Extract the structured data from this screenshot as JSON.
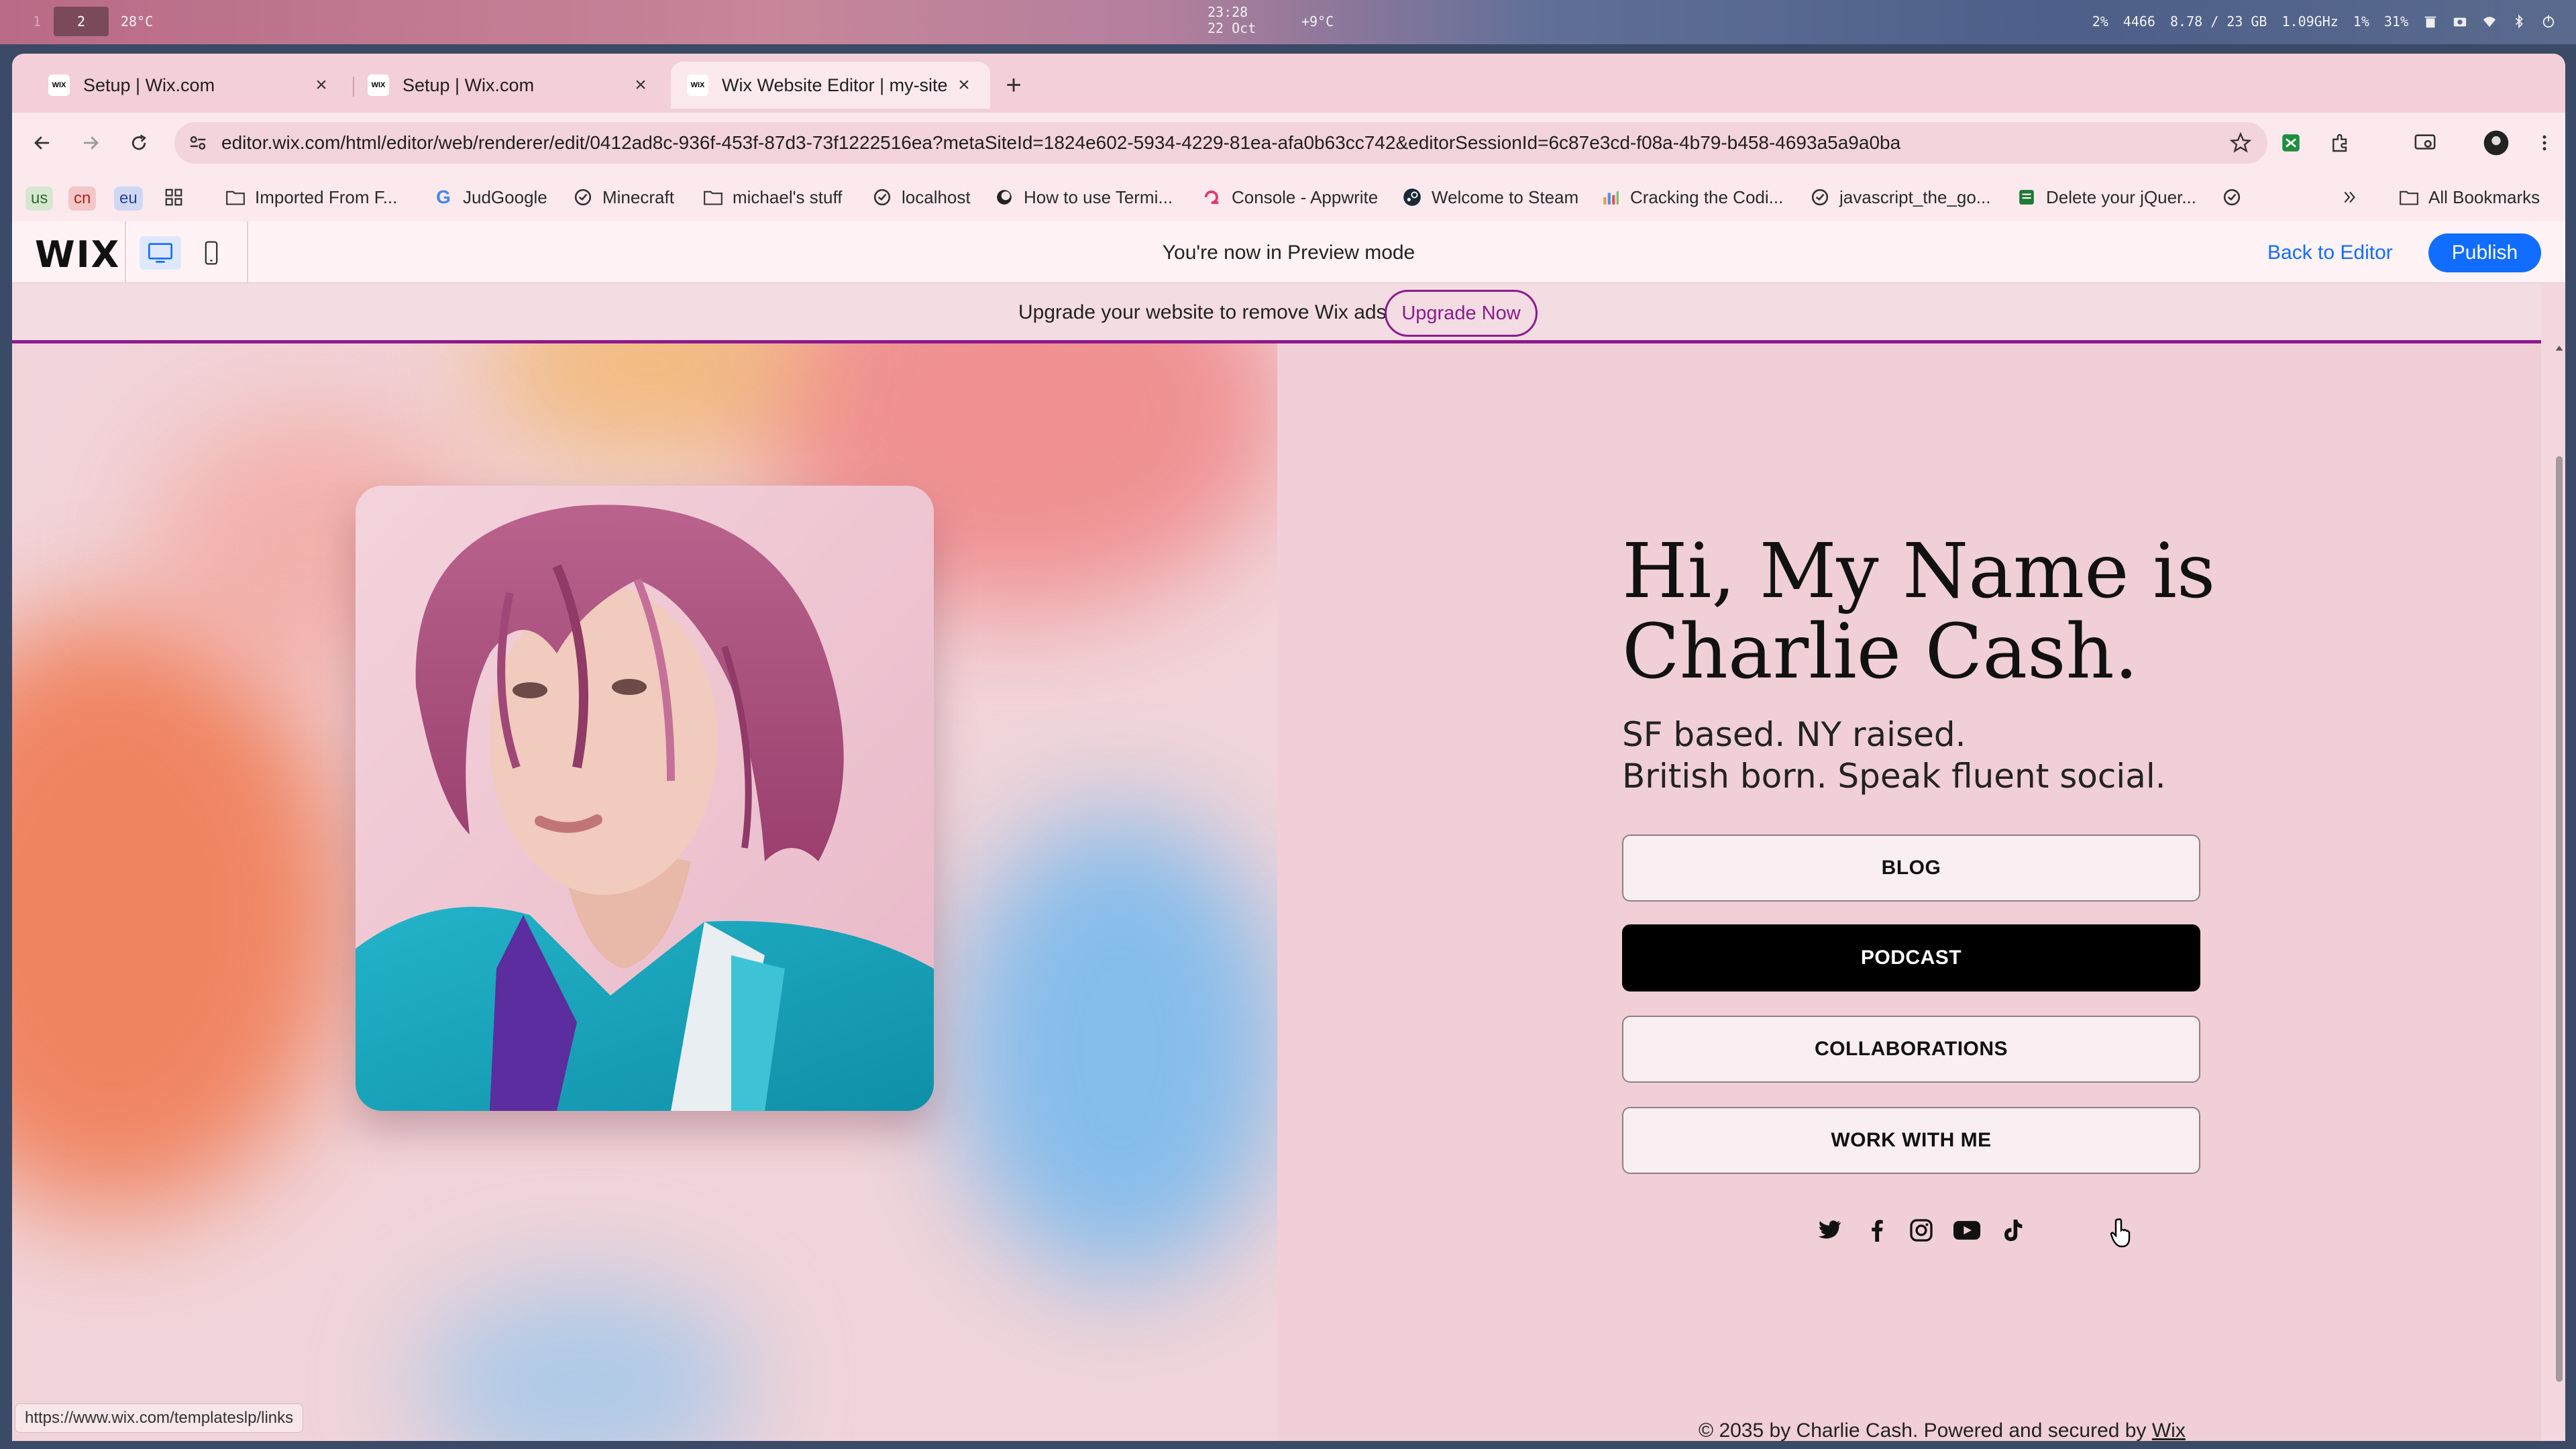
{
  "os_bar": {
    "workspace_inactive": "1",
    "workspace_active": "2",
    "temperature": "28°C",
    "time": "23:28",
    "date": "22 Oct",
    "weather": "+9°C",
    "cpu": "2%",
    "disk": "4466",
    "memory": "8.78 / 23 GB",
    "freq": "1.09GHz",
    "load": "1%",
    "battery": "31%"
  },
  "tabs": [
    {
      "title": "Setup | Wix.com",
      "favicon": "WIX"
    },
    {
      "title": "Setup | Wix.com",
      "favicon": "WIX"
    },
    {
      "title": "Wix Website Editor | my-site",
      "favicon": "WIX"
    }
  ],
  "address_bar": {
    "url": "editor.wix.com/html/editor/web/renderer/edit/0412ad8c-936f-453f-87d3-73f1222516ea?metaSiteId=1824e602-5934-4229-81ea-afa0b63cc742&editorSessionId=6c87e3cd-f08a-4b79-b458-4693a5a9a0ba"
  },
  "bookmarks": {
    "langs": [
      "us",
      "cn",
      "eu"
    ],
    "items": [
      {
        "label": "Imported From F...",
        "icon": "folder-icon"
      },
      {
        "label": "JudGoogle",
        "icon": "google-icon"
      },
      {
        "label": "Minecraft",
        "icon": "globe-icon"
      },
      {
        "label": "michael's stuff",
        "icon": "folder-icon"
      },
      {
        "label": "localhost",
        "icon": "globe-icon"
      },
      {
        "label": "How to use Termi...",
        "icon": "globe-icon"
      },
      {
        "label": "Console - Appwrite",
        "icon": "appwrite-icon"
      },
      {
        "label": "Welcome to Steam",
        "icon": "steam-icon"
      },
      {
        "label": "Cracking the Codi...",
        "icon": "chart-icon"
      },
      {
        "label": "javascript_the_go...",
        "icon": "globe-icon"
      },
      {
        "label": "Delete your jQuer...",
        "icon": "sheet-icon"
      }
    ],
    "all_bookmarks": "All Bookmarks"
  },
  "wix_bar": {
    "logo": "WIX",
    "preview_message": "You're now in Preview mode",
    "back_to_editor": "Back to Editor",
    "publish": "Publish"
  },
  "ad_banner": {
    "message": "Upgrade your website to remove Wix ads",
    "button": "Upgrade Now"
  },
  "hero": {
    "title_line1": "Hi, My Name is",
    "title_line2": "Charlie Cash.",
    "sub_line1": "SF based. NY raised.",
    "sub_line2": "British born. Speak fluent social."
  },
  "links": [
    {
      "label": "BLOG"
    },
    {
      "label": "PODCAST"
    },
    {
      "label": "COLLABORATIONS"
    },
    {
      "label": "WORK WITH ME"
    }
  ],
  "social": [
    "twitter-icon",
    "facebook-icon",
    "instagram-icon",
    "youtube-icon",
    "tiktok-icon"
  ],
  "footer": {
    "text": "© 2035 by Charlie Cash. Powered and secured by",
    "link": "Wix"
  },
  "status_url": "https://www.wix.com/templateslp/links",
  "colors": {
    "accent_blue": "#116dff",
    "upgrade_purple": "#8c1b8c",
    "page_pink": "#f0cfd6",
    "dark_button": "#000000"
  }
}
